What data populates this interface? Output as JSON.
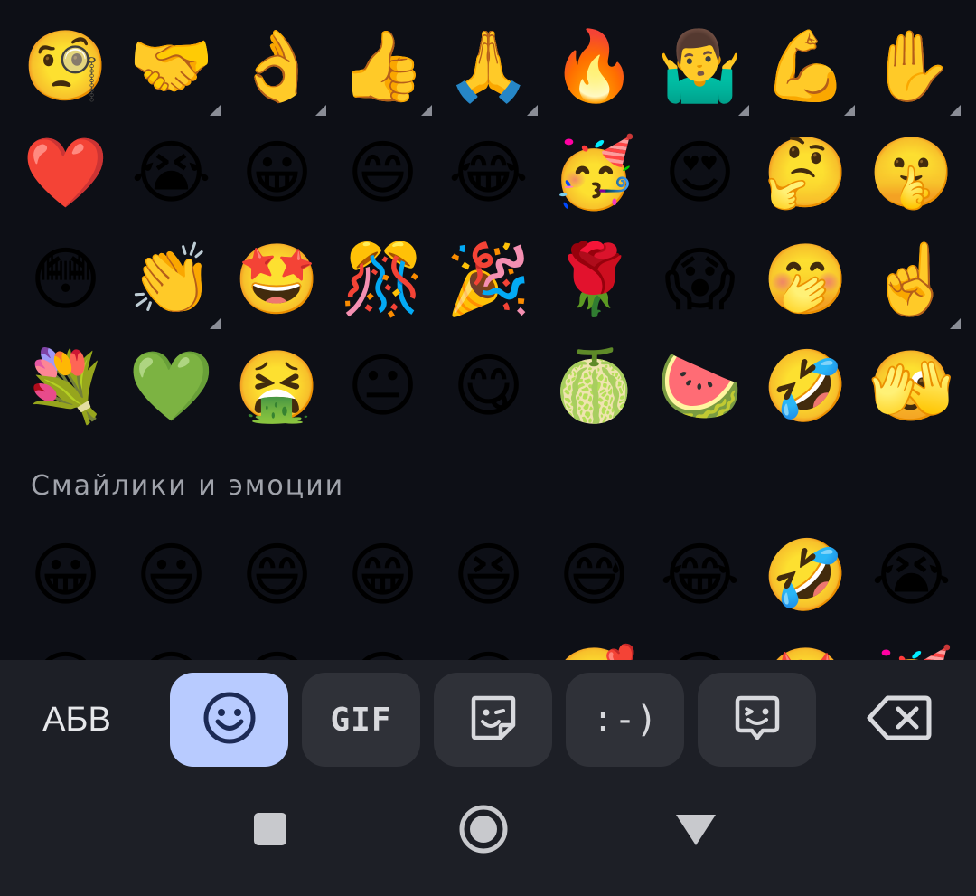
{
  "recent": [
    {
      "char": "🧐",
      "name": "monocle-face-emoji"
    },
    {
      "char": "🤝",
      "name": "handshake-emoji",
      "variants": true
    },
    {
      "char": "👌",
      "name": "ok-hand-emoji",
      "variants": true
    },
    {
      "char": "👍",
      "name": "thumbs-up-emoji",
      "variants": true
    },
    {
      "char": "🙏",
      "name": "folded-hands-emoji",
      "variants": true
    },
    {
      "char": "🔥",
      "name": "fire-emoji"
    },
    {
      "char": "🤷‍♂️",
      "name": "man-shrugging-emoji",
      "variants": true
    },
    {
      "char": "💪",
      "name": "flexed-biceps-emoji",
      "variants": true
    },
    {
      "char": "✋",
      "name": "raised-hand-emoji",
      "variants": true
    },
    {
      "char": "❤️",
      "name": "red-heart-emoji"
    },
    {
      "char": "😭",
      "name": "loudly-crying-face-emoji"
    },
    {
      "char": "😀",
      "name": "grinning-face-emoji"
    },
    {
      "char": "😄",
      "name": "grinning-smiling-eyes-emoji"
    },
    {
      "char": "😂",
      "name": "tears-of-joy-emoji"
    },
    {
      "char": "🥳",
      "name": "partying-face-emoji"
    },
    {
      "char": "😍",
      "name": "heart-eyes-emoji"
    },
    {
      "char": "🤔",
      "name": "thinking-face-emoji"
    },
    {
      "char": "🤫",
      "name": "shushing-face-emoji"
    },
    {
      "char": "😳",
      "name": "flushed-face-emoji"
    },
    {
      "char": "👏",
      "name": "clapping-hands-emoji",
      "variants": true
    },
    {
      "char": "🤩",
      "name": "star-struck-emoji"
    },
    {
      "char": "🎊",
      "name": "confetti-ball-emoji"
    },
    {
      "char": "🎉",
      "name": "party-popper-emoji"
    },
    {
      "char": "🌹",
      "name": "rose-emoji"
    },
    {
      "char": "😱",
      "name": "screaming-face-emoji"
    },
    {
      "char": "🤭",
      "name": "hand-over-mouth-emoji"
    },
    {
      "char": "☝️",
      "name": "index-pointing-up-emoji",
      "variants": true
    },
    {
      "char": "💐",
      "name": "bouquet-emoji"
    },
    {
      "char": "💚",
      "name": "green-heart-emoji"
    },
    {
      "char": "🤮",
      "name": "vomiting-face-emoji"
    },
    {
      "char": "😐",
      "name": "neutral-face-emoji"
    },
    {
      "char": "😋",
      "name": "savoring-food-emoji"
    },
    {
      "char": "🍈",
      "name": "melon-emoji"
    },
    {
      "char": "🍉",
      "name": "watermelon-emoji"
    },
    {
      "char": "🤣",
      "name": "rolling-on-floor-laughing-emoji"
    },
    {
      "char": "🫣",
      "name": "peeking-eye-emoji"
    }
  ],
  "section_title": "Смайлики и эмоции",
  "smileys": [
    {
      "char": "😀",
      "name": "grinning-face-emoji"
    },
    {
      "char": "😃",
      "name": "grinning-big-eyes-emoji"
    },
    {
      "char": "😄",
      "name": "grinning-smiling-eyes-emoji"
    },
    {
      "char": "😁",
      "name": "beaming-face-emoji"
    },
    {
      "char": "😆",
      "name": "squinting-laughing-emoji"
    },
    {
      "char": "😅",
      "name": "grinning-sweat-emoji"
    },
    {
      "char": "😂",
      "name": "tears-of-joy-emoji"
    },
    {
      "char": "🤣",
      "name": "rolling-on-floor-laughing-emoji"
    },
    {
      "char": "😭",
      "name": "loudly-crying-face-emoji"
    },
    {
      "char": "😉",
      "name": "winking-face-emoji"
    },
    {
      "char": "😗",
      "name": "kissing-face-emoji"
    },
    {
      "char": "😙",
      "name": "kissing-smiling-eyes-emoji"
    },
    {
      "char": "😚",
      "name": "kissing-closed-eyes-emoji"
    },
    {
      "char": "😘",
      "name": "face-blowing-kiss-emoji"
    },
    {
      "char": "🥰",
      "name": "smiling-hearts-emoji"
    },
    {
      "char": "😍",
      "name": "heart-eyes-emoji"
    },
    {
      "char": "🤩",
      "name": "star-struck-emoji"
    },
    {
      "char": "🥳",
      "name": "partying-face-emoji"
    }
  ],
  "toolbar": {
    "abc_label": "АБВ",
    "gif_label": "GIF",
    "emoticon_label": ":-)",
    "active_color": "#b8cbff",
    "button_color": "#2f3138",
    "icons": [
      "smiley-face-icon",
      "sticker-icon",
      "emoji-kitchen-icon",
      "backspace-icon"
    ]
  },
  "navbar": {
    "icons": [
      "recents-square-icon",
      "home-circle-icon",
      "back-triangle-icon"
    ]
  }
}
